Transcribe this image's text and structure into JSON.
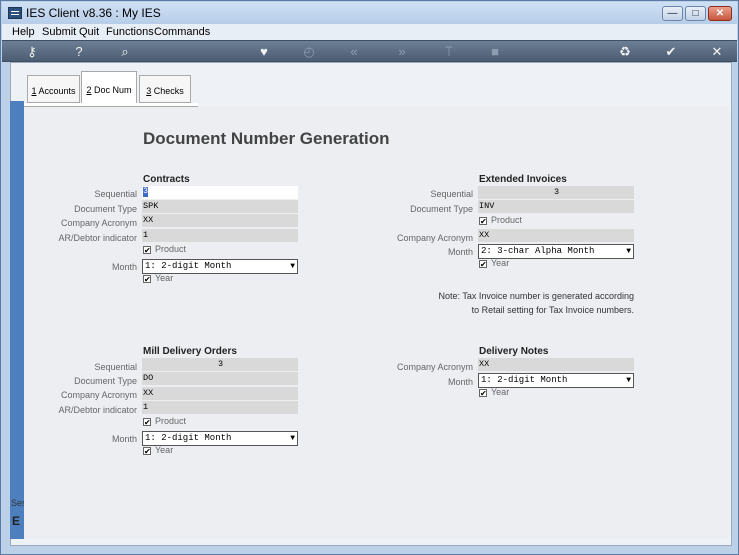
{
  "window": {
    "title": "IES Client v8.36 : My IES"
  },
  "menu": [
    "Help",
    "Submit",
    "Quit",
    "Functions",
    "Commands"
  ],
  "toolbar": {
    "key_icon": "⚷",
    "help_icon": "?",
    "search_icon": "⌕",
    "heart_icon": "♥",
    "clock_icon": "◴",
    "prev_icon": "«",
    "next_icon": "»",
    "ruler_icon": "⟙",
    "square_icon": "■",
    "recycle_icon": "♻",
    "ok_icon": "✔",
    "close_icon": "✕"
  },
  "tabs": [
    {
      "prefix": "1",
      "label": " Accounts"
    },
    {
      "prefix": "2",
      "label": " Doc Num"
    },
    {
      "prefix": "3",
      "label": " Checks"
    }
  ],
  "page_title": "Document Number Generation",
  "contracts": {
    "title": "Contracts",
    "labels": {
      "sequential": "Sequential",
      "doc_type": "Document Type",
      "acronym": "Company Acronym",
      "ar": "AR/Debtor indicator",
      "month": "Month"
    },
    "sequential": "3",
    "doc_type": "SPK",
    "acronym": "XX",
    "ar": "1",
    "product": "Product",
    "month": "1: 2-digit Month",
    "year": "Year"
  },
  "extended_invoices": {
    "title": "Extended Invoices",
    "labels": {
      "sequential": "Sequential",
      "doc_type": "Document Type",
      "acronym": "Company Acronym",
      "month": "Month"
    },
    "sequential": "3",
    "doc_type": "INV",
    "product": "Product",
    "acronym": "XX",
    "month": "2: 3-char Alpha Month",
    "year": "Year"
  },
  "note": {
    "line1": "Note: Tax Invoice number is generated according",
    "line2": "to Retail setting for Tax Invoice numbers."
  },
  "mill_delivery": {
    "title": "Mill Delivery Orders",
    "labels": {
      "sequential": "Sequential",
      "doc_type": "Document Type",
      "acronym": "Company Acronym",
      "ar": "AR/Debtor indicator",
      "month": "Month"
    },
    "sequential": "3",
    "doc_type": "DO",
    "acronym": "XX",
    "ar": "1",
    "product": "Product",
    "month": "1: 2-digit Month",
    "year": "Year"
  },
  "delivery_notes": {
    "title": "Delivery Notes",
    "labels": {
      "acronym": "Company Acronym",
      "month": "Month"
    },
    "acronym": "XX",
    "month": "1: 2-digit Month",
    "year": "Year"
  },
  "left_strip": {
    "label": "Ses",
    "icon": "E"
  },
  "check_mark": "✔",
  "dropdown_arrow": "▼"
}
